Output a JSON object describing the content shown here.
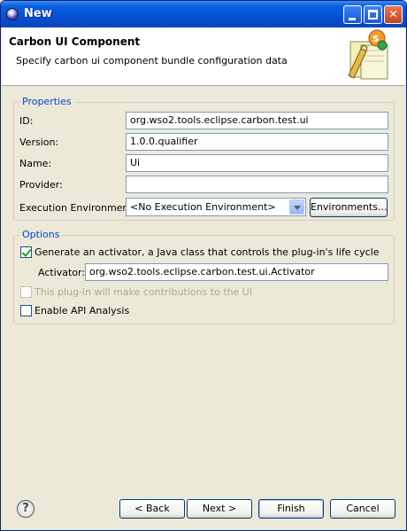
{
  "window": {
    "title": "New"
  },
  "header": {
    "title": "Carbon UI Component",
    "description": "Specify carbon ui component bundle configuration data"
  },
  "properties": {
    "group_label": "Properties",
    "id_label": "ID:",
    "id_value": "org.wso2.tools.eclipse.carbon.test.ui",
    "version_label": "Version:",
    "version_value": "1.0.0.qualifier",
    "name_label": "Name:",
    "name_value": "Ui",
    "provider_label": "Provider:",
    "provider_value": "",
    "exec_env_label": "Execution Environment:",
    "exec_env_value": "<No Execution Environment>",
    "environments_button": "Environments..."
  },
  "options": {
    "group_label": "Options",
    "generate_activator_label": "Generate an activator, a Java class that controls the plug-in's life cycle",
    "generate_activator_checked": true,
    "activator_label": "Activator:",
    "activator_value": "org.wso2.tools.eclipse.carbon.test.ui.Activator",
    "ui_contrib_label": "This plug-in will make contributions to the UI",
    "ui_contrib_checked": false,
    "api_analysis_label": "Enable API Analysis",
    "api_analysis_checked": false
  },
  "footer": {
    "back_button": "< Back",
    "next_button": "Next >",
    "finish_button": "Finish",
    "cancel_button": "Cancel",
    "help_icon_glyph": "?"
  }
}
